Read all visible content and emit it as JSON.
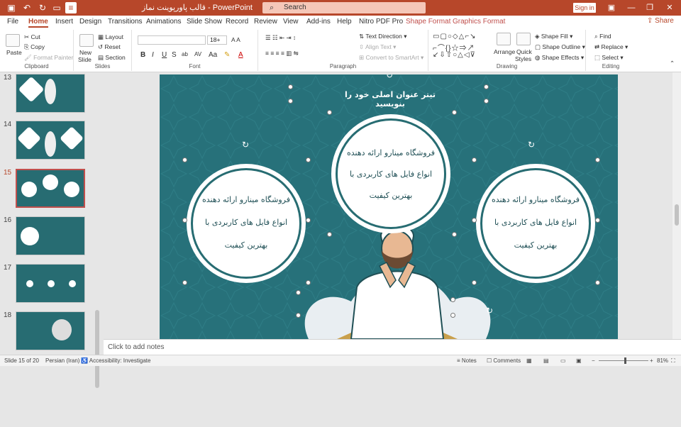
{
  "app": {
    "doc_title": "قالب پاورپوینت نماز",
    "separator": "-",
    "app_name": "PowerPoint",
    "search_placeholder": "Search",
    "signin": "Sign in",
    "share": "Share"
  },
  "tabs": [
    "File",
    "Home",
    "Insert",
    "Design",
    "Transitions",
    "Animations",
    "Slide Show",
    "Record",
    "Review",
    "View",
    "Add-ins",
    "Help",
    "Nitro PDF Pro",
    "Shape Format",
    "Graphics Format"
  ],
  "ribbon": {
    "clipboard": {
      "label": "Clipboard",
      "paste": "Paste",
      "cut": "Cut",
      "copy": "Copy",
      "format_painter": "Format Painter"
    },
    "slides": {
      "label": "Slides",
      "new_slide": "New",
      "new_slide2": "Slide",
      "layout": "Layout",
      "reset": "Reset",
      "section": "Section"
    },
    "font": {
      "label": "Font",
      "size": "18+",
      "buttons": [
        "B",
        "I",
        "U",
        "S",
        "ab",
        "AV",
        "Aa"
      ]
    },
    "paragraph": {
      "label": "Paragraph",
      "text_direction": "Text Direction",
      "align_text": "Align Text",
      "smartart": "Convert to SmartArt"
    },
    "drawing": {
      "label": "Drawing",
      "arrange": "Arrange",
      "quick_styles": "Quick",
      "quick_styles2": "Styles",
      "shape_fill": "Shape Fill",
      "shape_outline": "Shape Outline",
      "shape_effects": "Shape Effects"
    },
    "editing": {
      "label": "Editing",
      "find": "Find",
      "replace": "Replace",
      "select": "Select"
    }
  },
  "thumbnails": [
    {
      "num": "13"
    },
    {
      "num": "14"
    },
    {
      "num": "15",
      "active": true
    },
    {
      "num": "16"
    },
    {
      "num": "17"
    },
    {
      "num": "18"
    }
  ],
  "slide": {
    "title": "تیتر عنوان اصلی خود را بنویسید",
    "circles": [
      {
        "line1": "فروشگاه مینارو ارائه دهنده",
        "line2": "انواع فایل های کاربردی با",
        "line3": "بهترین کیفیت"
      },
      {
        "line1": "فروشگاه مینارو ارائه دهنده",
        "line2": "انواع فایل های کاربردی با",
        "line3": "بهترین کیفیت"
      },
      {
        "line1": "فروشگاه مینارو ارائه دهنده",
        "line2": "انواع فایل های کاربردی با",
        "line3": "بهترین کیفیت"
      }
    ]
  },
  "notes_placeholder": "Click to add notes",
  "status": {
    "slide": "Slide 15 of 20",
    "language": "Persian (Iran)",
    "accessibility": "Accessibility: Investigate",
    "notes": "Notes",
    "comments": "Comments",
    "zoom": "81%"
  },
  "colors": {
    "accent": "#b7472a",
    "slide_bg": "#27717a",
    "circle_border": "#276c72"
  }
}
